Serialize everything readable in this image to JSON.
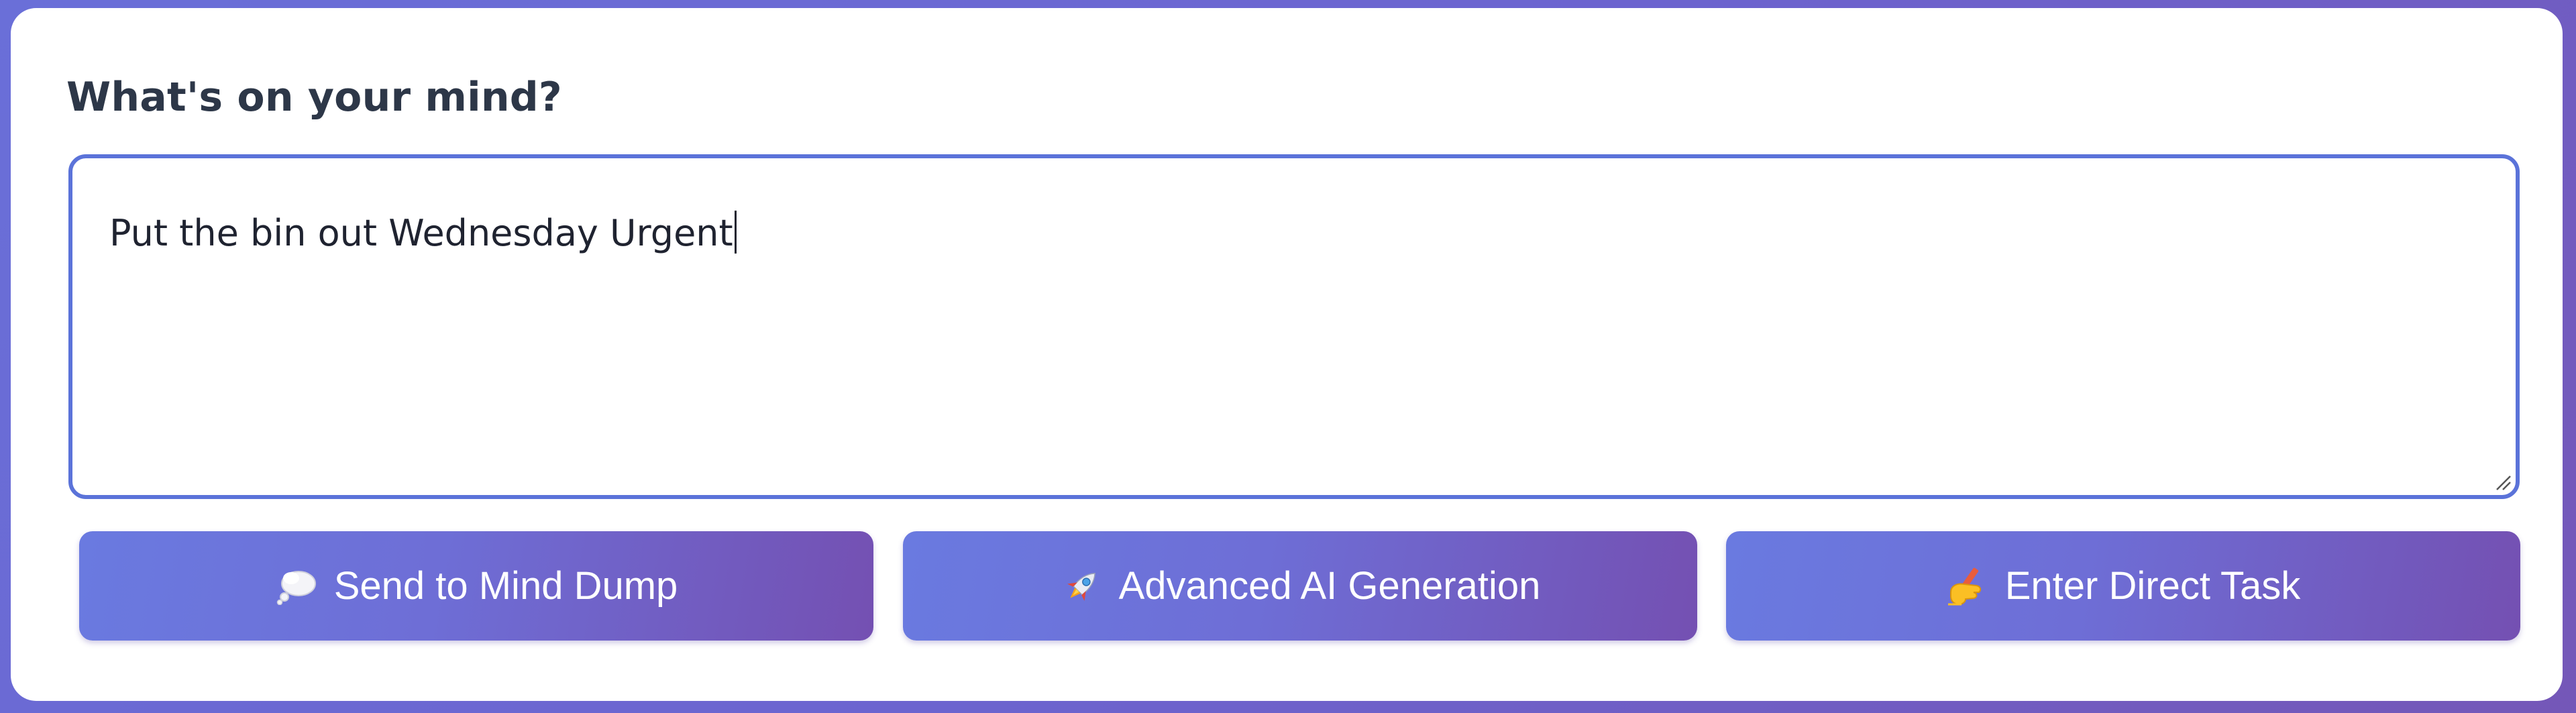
{
  "prompt": {
    "label": "What's on your mind?"
  },
  "input": {
    "value": "Put the bin out Wednesday Urgent"
  },
  "actions": [
    {
      "label": "Send to Mind Dump",
      "icon": "thought-bubble-icon"
    },
    {
      "label": "Advanced AI Generation",
      "icon": "rocket-icon"
    },
    {
      "label": "Enter Direct Task",
      "icon": "writing-hand-icon"
    }
  ],
  "colors": {
    "background": "#6c64cf",
    "input_border": "#5b73d9",
    "button_start": "#6a7ae0",
    "button_end": "#7450b2"
  }
}
